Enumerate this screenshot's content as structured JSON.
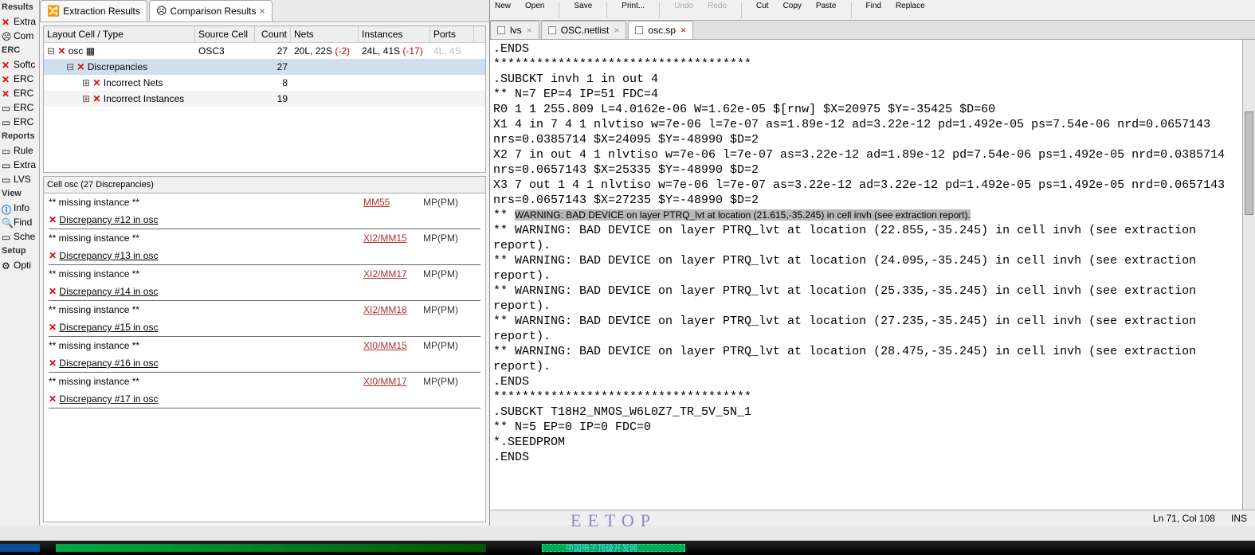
{
  "leftPanel": {
    "h1": "Results",
    "i1": "Extra",
    "i2": "Com",
    "h2": "ERC",
    "i3": "Softc",
    "i4": "ERC",
    "i5": "ERC",
    "i6": "ERC",
    "i7": "ERC",
    "h3": "Reports",
    "i8": "Rule",
    "i9": "Extra",
    "i10": "LVS",
    "h4": "View",
    "i11": "Info",
    "i12": "Find",
    "i13": "Sche",
    "h5": "Setup",
    "i14": "Opti"
  },
  "tabs": {
    "t1": "Extraction Results",
    "t2": "Comparison Results"
  },
  "treeHdr": {
    "c1": "Layout Cell / Type",
    "c2": "Source Cell",
    "c3": "Count",
    "c4": "Nets",
    "c5": "Instances",
    "c6": "Ports"
  },
  "tree": {
    "r1": {
      "name": "osc",
      "src": "OSC3",
      "cnt": "27",
      "nets": "20L, 22S",
      "netsD": "(-2)",
      "inst": "24L, 41S",
      "instD": "(-17)",
      "ports": "4L, 4S"
    },
    "r2": {
      "name": "Discrepancies",
      "cnt": "27"
    },
    "r3": {
      "name": "Incorrect Nets",
      "cnt": "8"
    },
    "r4": {
      "name": "Incorrect Instances",
      "cnt": "19"
    }
  },
  "detailHdr": "Cell osc (27 Discrepancies)",
  "details": [
    {
      "t": "miss",
      "txt": "** missing instance **",
      "link": "MM55",
      "typ": "MP(PM)"
    },
    {
      "t": "disc",
      "txt": "Discrepancy #12 in osc"
    },
    {
      "t": "miss",
      "txt": "** missing instance **",
      "link": "XI2/MM15",
      "typ": "MP(PM)"
    },
    {
      "t": "disc",
      "txt": "Discrepancy #13 in osc"
    },
    {
      "t": "miss",
      "txt": "** missing instance **",
      "link": "XI2/MM17",
      "typ": "MP(PM)"
    },
    {
      "t": "disc",
      "txt": "Discrepancy #14 in osc"
    },
    {
      "t": "miss",
      "txt": "** missing instance **",
      "link": "XI2/MM18",
      "typ": "MP(PM)"
    },
    {
      "t": "disc",
      "txt": "Discrepancy #15 in osc"
    },
    {
      "t": "miss",
      "txt": "** missing instance **",
      "link": "XI0/MM15",
      "typ": "MP(PM)"
    },
    {
      "t": "disc",
      "txt": "Discrepancy #16 in osc"
    },
    {
      "t": "miss",
      "txt": "** missing instance **",
      "link": "XI0/MM17",
      "typ": "MP(PM)"
    },
    {
      "t": "disc",
      "txt": "Discrepancy #17 in osc"
    }
  ],
  "toolbar": {
    "new": "New",
    "open": "Open",
    "save": "Save",
    "print": "Print...",
    "undo": "Undo",
    "redo": "Redo",
    "cut": "Cut",
    "copy": "Copy",
    "paste": "Paste",
    "find": "Find",
    "replace": "Replace"
  },
  "edTabs": {
    "t1": "lvs",
    "t2": "OSC.netlist",
    "t3": "osc.sp"
  },
  "editor": {
    "l1": ".ENDS",
    "l2": "************************************",
    "l3": ".SUBCKT invh 1 in out 4",
    "l4": "** N=7 EP=4 IP=51 FDC=4",
    "l5": "R0 1 1 255.809 L=4.0162e-06 W=1.62e-05 $[rnw] $X=20975 $Y=-35425 $D=60",
    "l6": "X1 4 in 7 4 1 nlvtiso w=7e-06 l=7e-07 as=1.89e-12 ad=3.22e-12 pd=1.492e-05 ps=7.54e-06 nrd=0.0657143 nrs=0.0385714 $X=24095 $Y=-48990 $D=2",
    "l7": "X2 7 in out 4 1 nlvtiso w=7e-06 l=7e-07 as=3.22e-12 ad=1.89e-12 pd=7.54e-06 ps=1.492e-05 nrd=0.0385714 nrs=0.0657143 $X=25335 $Y=-48990 $D=2",
    "l8": "X3 7 out 1 4 1 nlvtiso w=7e-06 l=7e-07 as=3.22e-12 ad=3.22e-12 pd=1.492e-05 ps=1.492e-05 nrd=0.0657143 nrs=0.0657143 $X=27235 $Y=-48990 $D=2",
    "l9a": "** ",
    "l9b": "WARNING: BAD DEVICE on layer PTRQ_lvt at location (21.615,-35.245) in cell invh (see extraction report).",
    "l10": "** WARNING: BAD DEVICE on layer PTRQ_lvt at location (22.855,-35.245) in cell invh (see extraction report).",
    "l11": "** WARNING: BAD DEVICE on layer PTRQ_lvt at location (24.095,-35.245) in cell invh (see extraction report).",
    "l12": "** WARNING: BAD DEVICE on layer PTRQ_lvt at location (25.335,-35.245) in cell invh (see extraction report).",
    "l13": "** WARNING: BAD DEVICE on layer PTRQ_lvt at location (27.235,-35.245) in cell invh (see extraction report).",
    "l14": "** WARNING: BAD DEVICE on layer PTRQ_lvt at location (28.475,-35.245) in cell invh (see extraction report).",
    "l15": ".ENDS",
    "l16": "************************************",
    "l17": ".SUBCKT T18H2_NMOS_W6L0Z7_TR_5V_5N_1",
    "l18": "** N=5 EP=0 IP=0 FDC=0",
    "l19": "*.SEEDPROM",
    "l20": ".ENDS"
  },
  "status": {
    "pos": "Ln 71, Col 108",
    "mode": "INS"
  },
  "watermark": "EETOP",
  "bbTxt": "中国电子顶级开发网"
}
